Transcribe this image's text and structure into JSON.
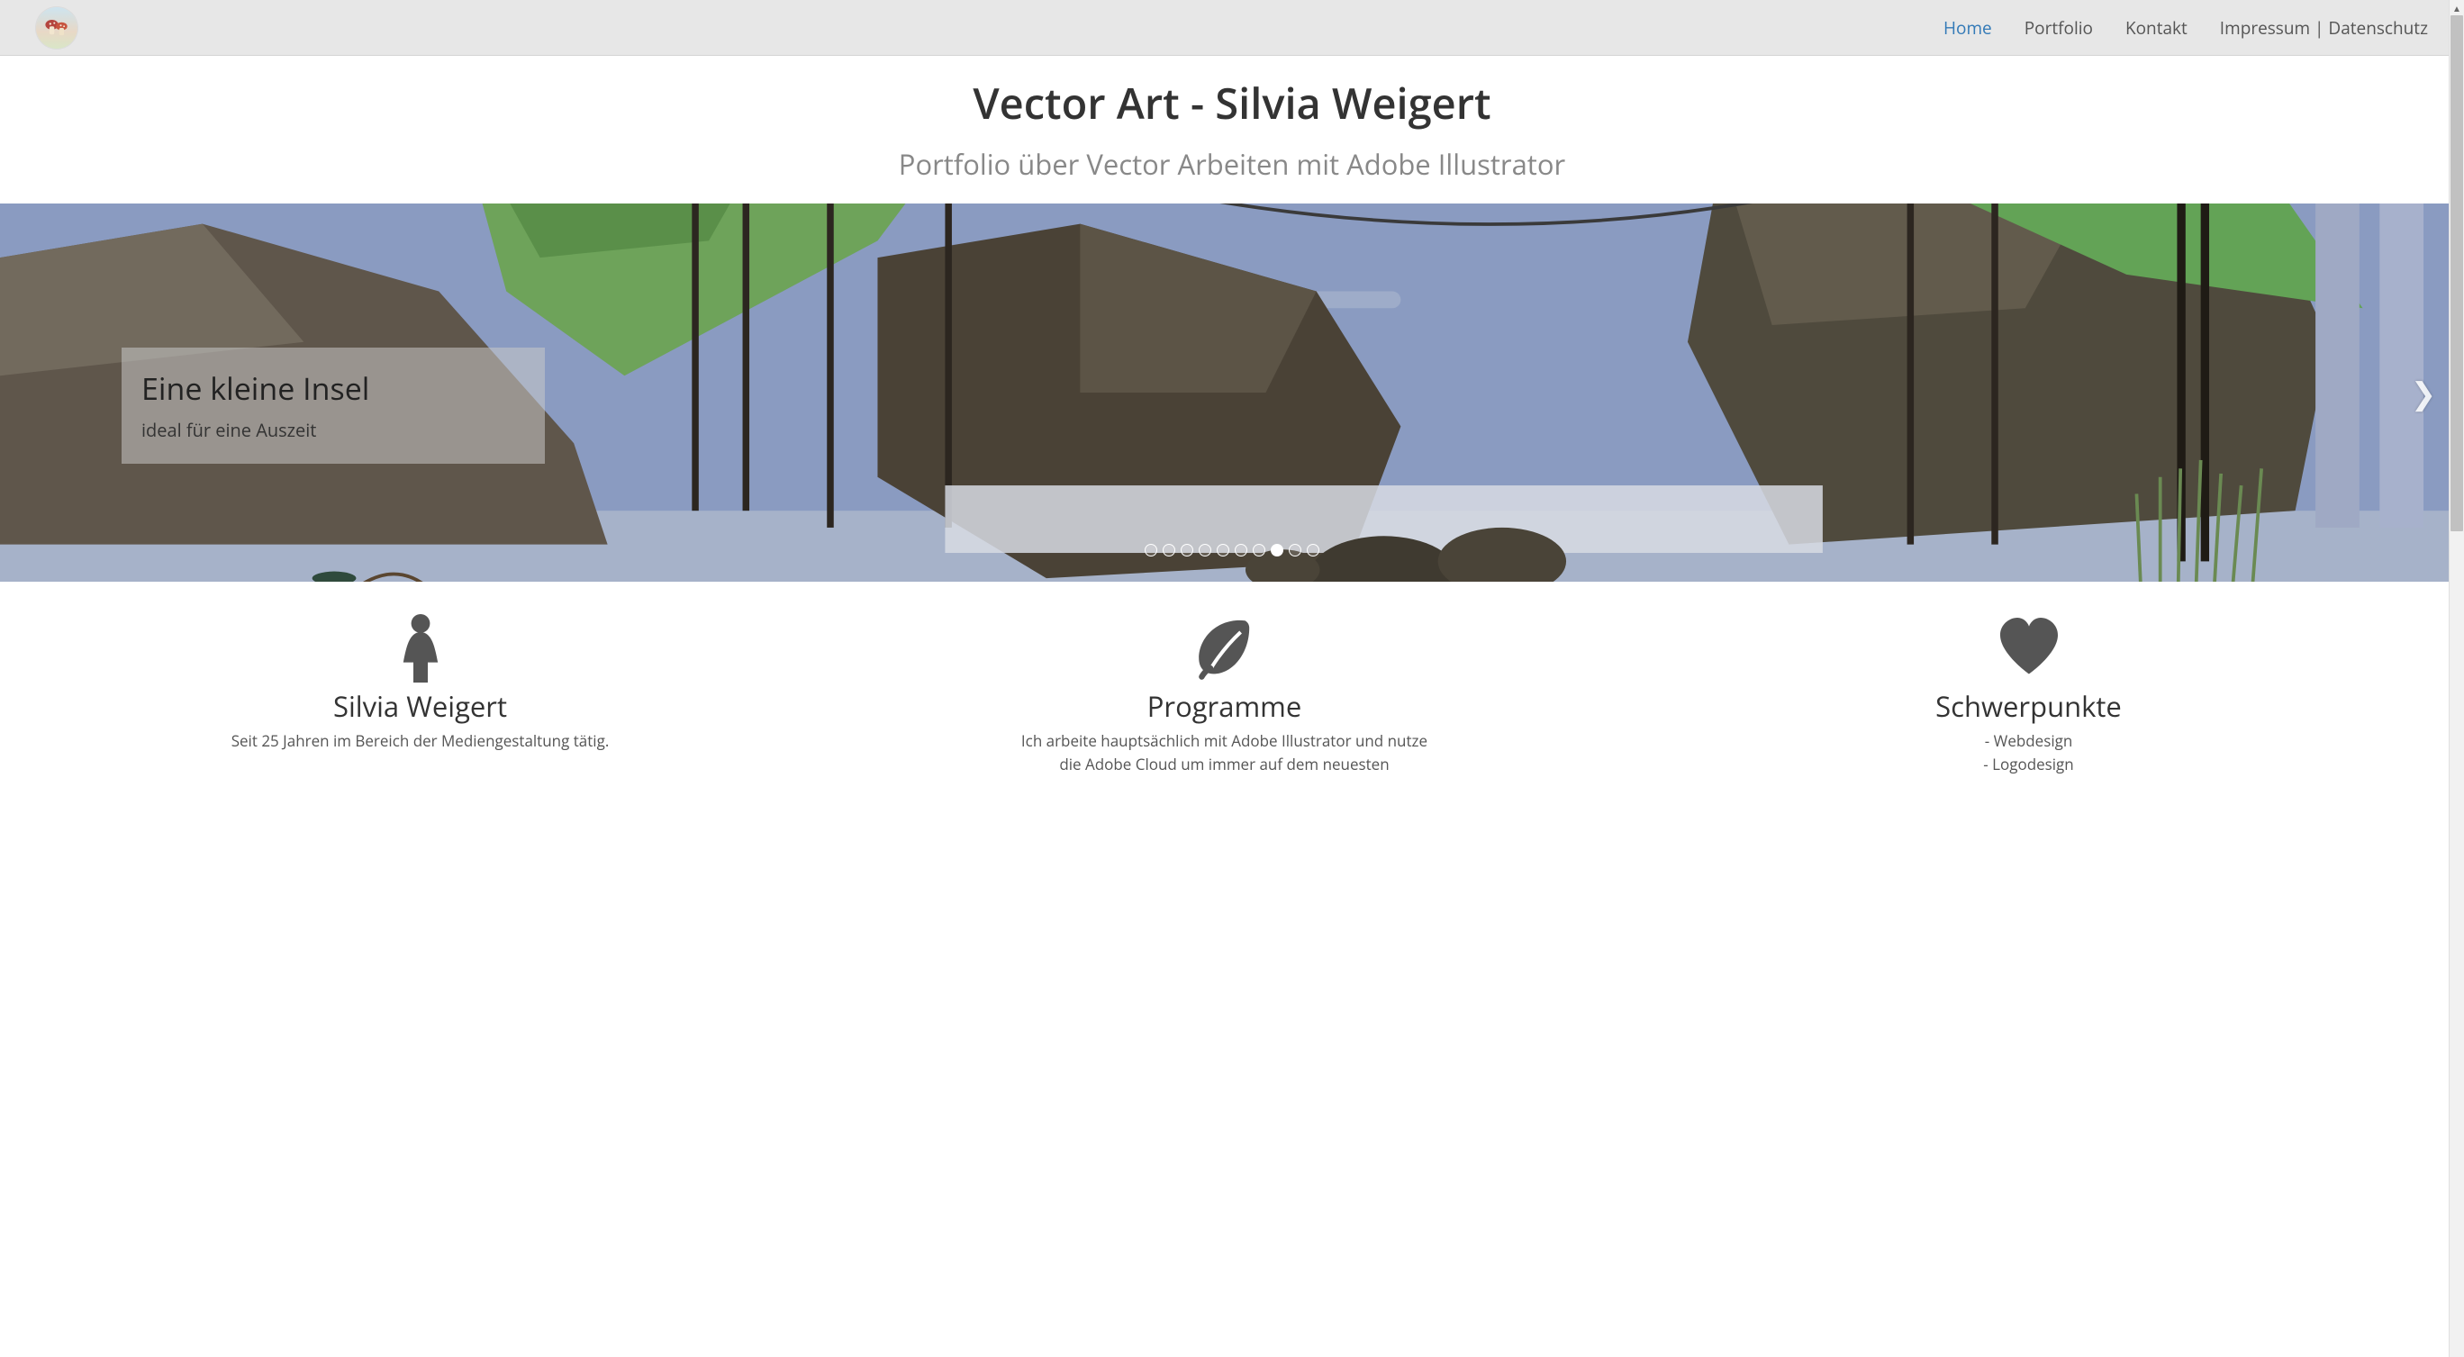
{
  "nav": {
    "items": [
      {
        "label": "Home",
        "active": true
      },
      {
        "label": "Portfolio",
        "active": false
      },
      {
        "label": "Kontakt",
        "active": false
      },
      {
        "label": "Impressum | Datenschutz",
        "active": false
      }
    ]
  },
  "hero": {
    "title": "Vector Art - Silvia Weigert",
    "subtitle": "Portfolio über Vector Arbeiten mit Adobe Illustrator"
  },
  "carousel": {
    "caption_title": "Eine kleine Insel",
    "caption_text": "ideal für eine Auszeit",
    "slide_count": 10,
    "active_index": 7
  },
  "features": [
    {
      "icon": "female-icon",
      "title": "Silvia Weigert",
      "text": "Seit 25 Jahren im Bereich der Mediengestaltung tätig."
    },
    {
      "icon": "leaf-icon",
      "title": "Programme",
      "text": "Ich arbeite hauptsächlich mit Adobe Illustrator und nutze die Adobe Cloud um immer auf dem neuesten"
    },
    {
      "icon": "heart-icon",
      "title": "Schwerpunkte",
      "text": "- Webdesign\n- Logodesign"
    }
  ]
}
